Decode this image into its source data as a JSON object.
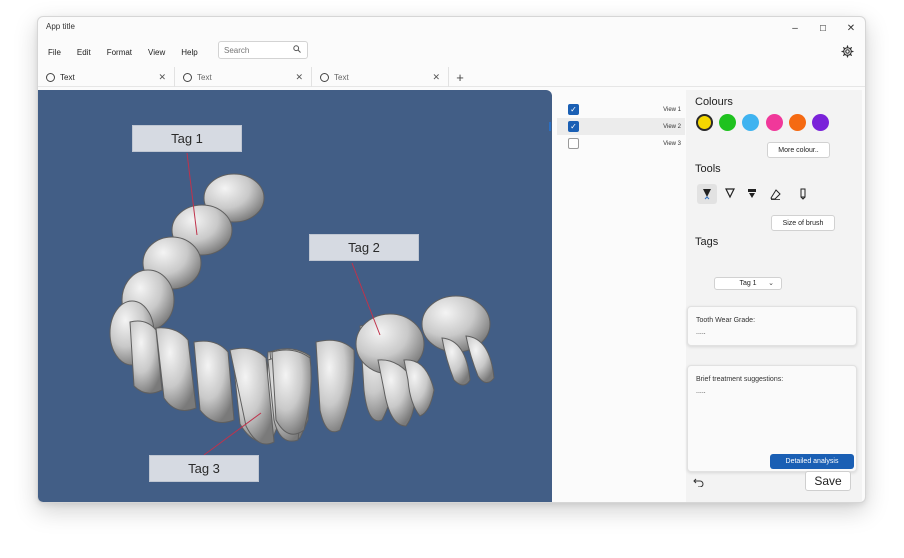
{
  "window": {
    "title": "App title"
  },
  "window_controls": {
    "minimize": "–",
    "maximize": "☐",
    "close": "✕"
  },
  "menu": [
    "File",
    "Edit",
    "Format",
    "View",
    "Help"
  ],
  "search": {
    "placeholder": "Search",
    "icon": "search-icon"
  },
  "tabs": [
    {
      "label": "Text",
      "active": true
    },
    {
      "label": "Text",
      "active": false
    },
    {
      "label": "Text",
      "active": false
    }
  ],
  "viewport": {
    "background": "#425e86",
    "tags": [
      {
        "label": "Tag 1"
      },
      {
        "label": "Tag 2"
      },
      {
        "label": "Tag 3"
      }
    ]
  },
  "views": [
    {
      "label": "View 1",
      "checked": true
    },
    {
      "label": "View 2",
      "checked": true,
      "selected": true
    },
    {
      "label": "View 3",
      "checked": false
    }
  ],
  "side": {
    "colours_title": "Colours",
    "colours": [
      "#f5d800",
      "#1fc21f",
      "#3fb3f0",
      "#f0389a",
      "#f56a12",
      "#7a22d9"
    ],
    "selected_colour": "#f5d800",
    "more_colours": "More colour..",
    "tools_title": "Tools",
    "tools": [
      "brush-fill-icon",
      "brush-outline-icon",
      "brush-flat-icon",
      "eraser-icon",
      "marker-icon"
    ],
    "size_of_brush": "Size of brush",
    "tags_title": "Tags",
    "tag_selected": "Tag 1",
    "wear_label": "Tooth Wear Grade:",
    "wear_value": ".....",
    "treatment_label": "Brief treatment suggestions:",
    "treatment_value": ".....",
    "detailed_analysis": "Detailed analysis",
    "save": "Save"
  }
}
